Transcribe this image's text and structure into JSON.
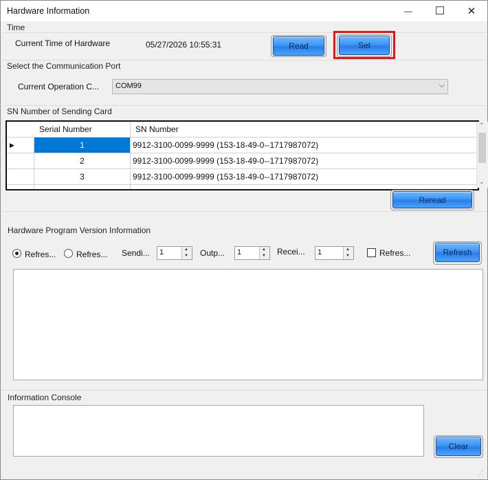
{
  "window": {
    "title": "Hardware Information",
    "minimize_glyph": "—",
    "maximize_glyph": "☐",
    "close_glyph": "✕"
  },
  "time_group": {
    "title": "Time",
    "label": "Current Time of Hardware",
    "value": "05/27/2026 10:55:31",
    "read_label": "Read",
    "set_label": "Set"
  },
  "port_group": {
    "title": "Select the Communication Port",
    "label": "Current Operation C...",
    "selected": "COM99"
  },
  "sn_group": {
    "title": "SN Number of Sending Card",
    "columns": [
      "Serial Number",
      "SN Number"
    ],
    "rows": [
      {
        "serial": "1",
        "sn": "9912-3100-0099-9999  (153-18-49-0--1717987072)"
      },
      {
        "serial": "2",
        "sn": "9912-3100-0099-9999  (153-18-49-0--1717987072)"
      },
      {
        "serial": "3",
        "sn": "9912-3100-0099-9999  (153-18-49-0--1717987072)"
      }
    ],
    "reread_label": "Reread"
  },
  "version_group": {
    "title": "Hardware Program Version Information",
    "radio1_label": "Refres...",
    "radio2_label": "Refres...",
    "sending_label": "Sendi...",
    "sending_value": "1",
    "output_label": "Outp...",
    "output_value": "1",
    "receiving_label": "Recei...",
    "receiving_value": "1",
    "checkbox_label": "Refres...",
    "refresh_label": "Refresh"
  },
  "console_group": {
    "title": "Information Console",
    "clear_label": "Clear"
  },
  "colors": {
    "selected_cell": "#0078d7",
    "highlight_border": "#e01818",
    "button_blue": "#3f95f5"
  }
}
